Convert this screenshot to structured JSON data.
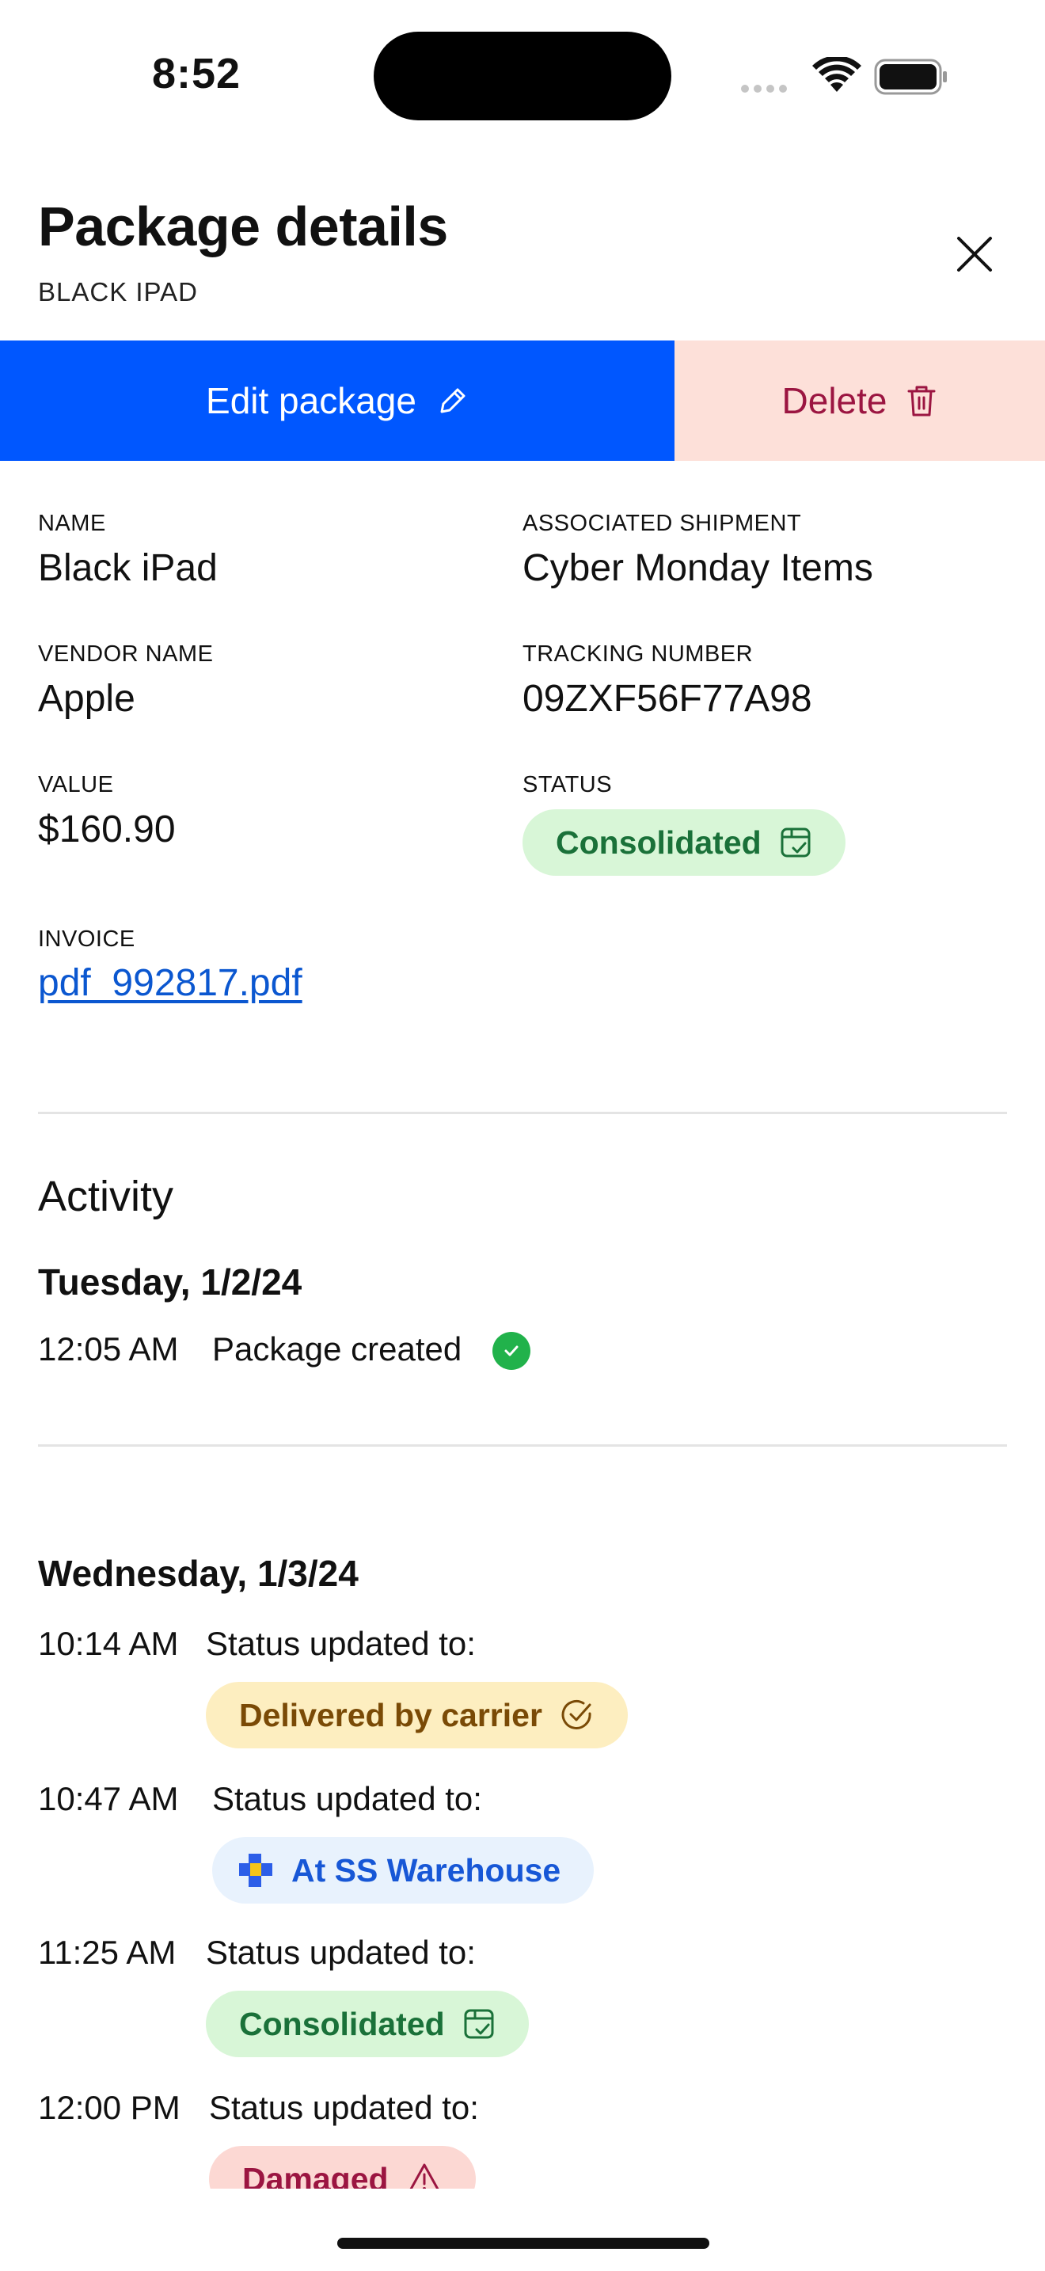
{
  "status_bar": {
    "time": "8:52"
  },
  "header": {
    "title": "Package details",
    "subtitle": "BLACK IPAD"
  },
  "actions": {
    "edit_label": "Edit package",
    "delete_label": "Delete"
  },
  "details": {
    "name_label": "NAME",
    "name_value": "Black iPad",
    "shipment_label": "ASSOCIATED SHIPMENT",
    "shipment_value": "Cyber Monday Items",
    "vendor_label": "VENDOR NAME",
    "vendor_value": "Apple",
    "tracking_label": "TRACKING NUMBER",
    "tracking_value": "09ZXF56F77A98",
    "value_label": "VALUE",
    "value_value": "$160.90",
    "status_label": "STATUS",
    "status_value": "Consolidated",
    "invoice_label": "INVOICE",
    "invoice_value": "pdf_992817.pdf"
  },
  "activity": {
    "heading": "Activity",
    "days": [
      {
        "date": "Tuesday, 1/2/24",
        "entries": [
          {
            "time": "12:05 AM",
            "text": "Package created"
          }
        ]
      },
      {
        "date": "Wednesday, 1/3/24",
        "entries": [
          {
            "time": "10:14 AM",
            "text": "Status updated to:",
            "status": "Delivered by carrier"
          },
          {
            "time": "10:47 AM",
            "text": "Status updated to:",
            "status": "At SS Warehouse"
          },
          {
            "time": "11:25 AM",
            "text": "Status updated to:",
            "status": "Consolidated"
          },
          {
            "time": "12:00 PM",
            "text": "Status updated to:",
            "status": "Damaged"
          }
        ]
      }
    ]
  },
  "colors": {
    "primary": "#0057ff",
    "danger_bg": "#fde0d9",
    "danger_text": "#9b1541",
    "consolidated_bg": "#d8f6d7",
    "delivered_bg": "#fdeec0",
    "warehouse_bg": "#e8f2fd",
    "damaged_bg": "#fcd8d3"
  },
  "icons": [
    "wifi-icon",
    "battery-icon",
    "close-icon",
    "pencil-icon",
    "trash-icon",
    "box-check-icon",
    "check-circle-icon",
    "warehouse-logo-icon",
    "warning-icon"
  ]
}
